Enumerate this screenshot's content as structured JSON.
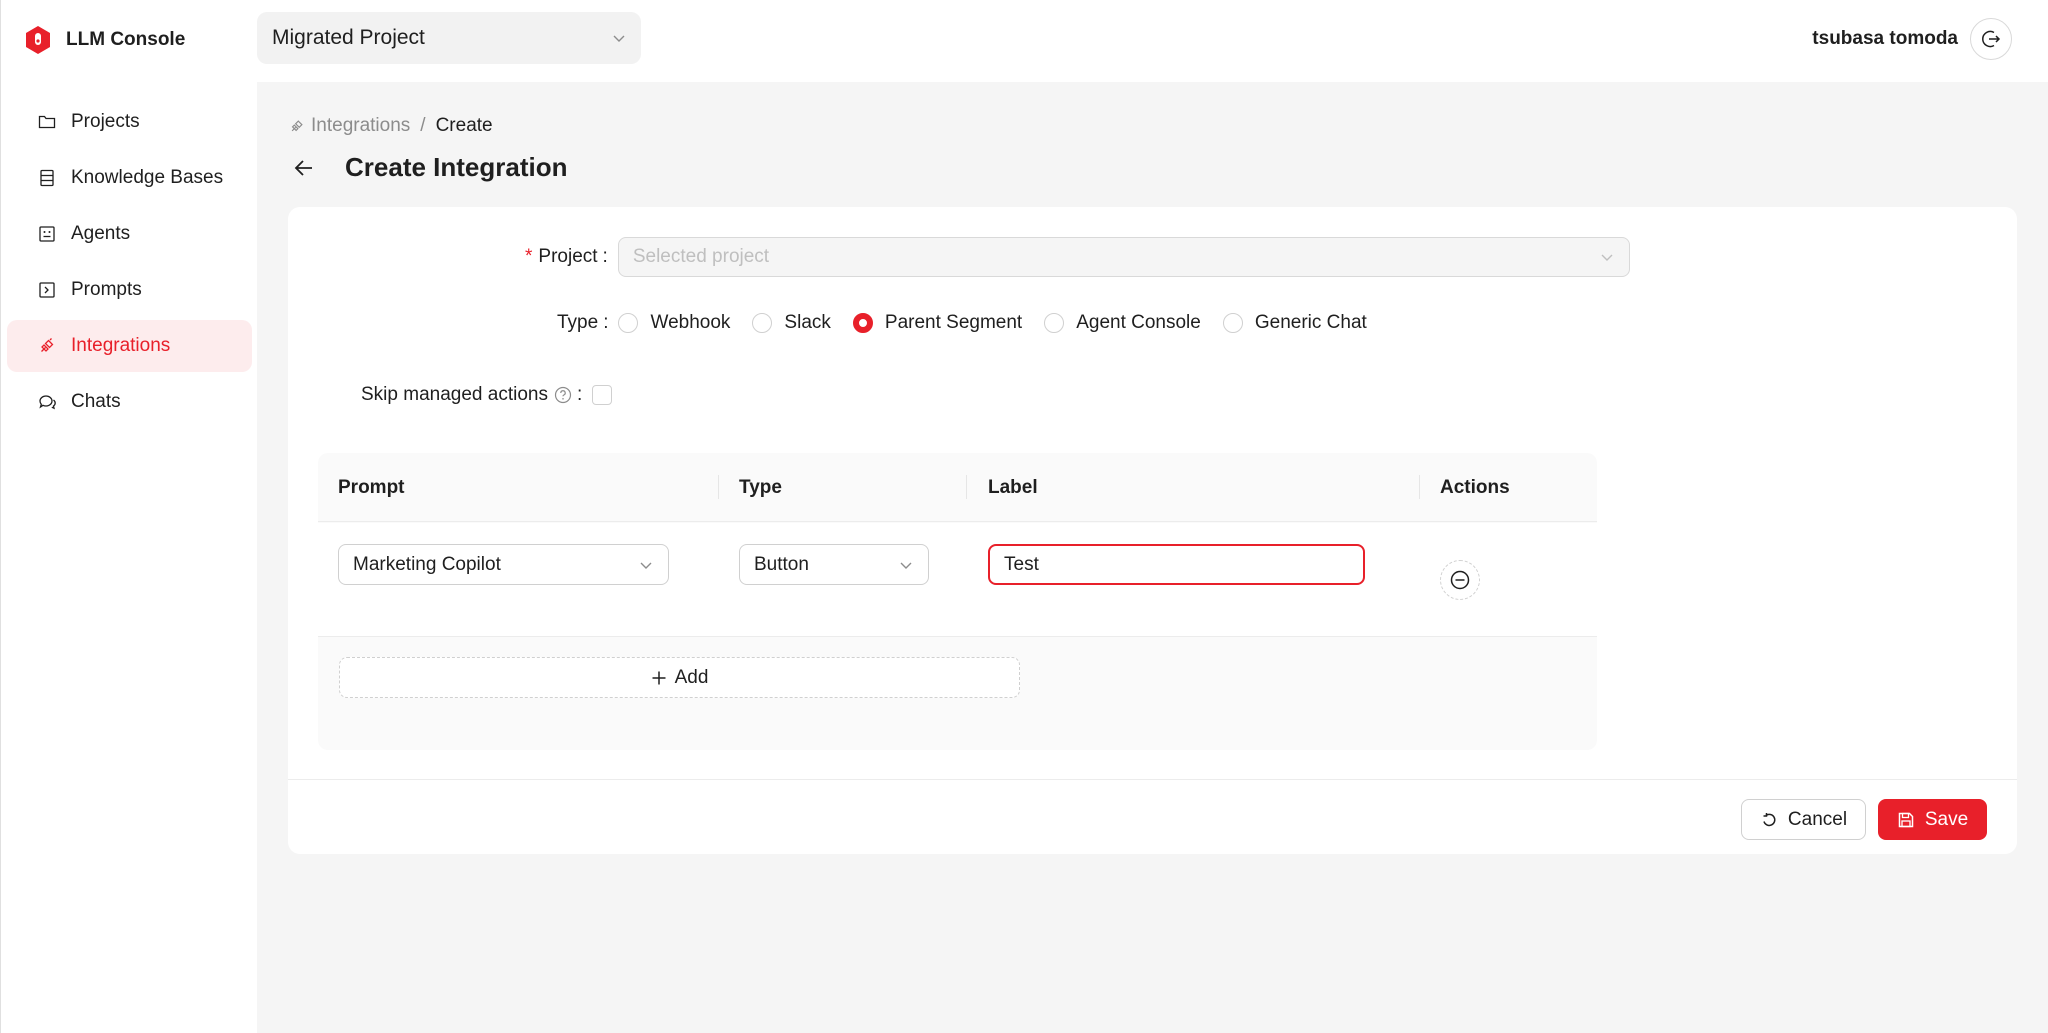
{
  "app": {
    "name": "LLM Console",
    "brand_color": "#e8202a"
  },
  "sidebar": {
    "items": [
      {
        "label": "Projects",
        "icon": "folder-icon",
        "active": false
      },
      {
        "label": "Knowledge Bases",
        "icon": "database-icon",
        "active": false
      },
      {
        "label": "Agents",
        "icon": "robot-icon",
        "active": false
      },
      {
        "label": "Prompts",
        "icon": "prompt-icon",
        "active": false
      },
      {
        "label": "Integrations",
        "icon": "plug-icon",
        "active": true
      },
      {
        "label": "Chats",
        "icon": "chat-icon",
        "active": false
      }
    ]
  },
  "header": {
    "project_selector": {
      "value": "Migrated Project",
      "icon": "chevron-down-icon"
    },
    "user_name": "tsubasa tomoda",
    "logout_icon": "logout-icon"
  },
  "breadcrumb": {
    "link": "Integrations",
    "separator": "/",
    "current": "Create"
  },
  "page_title": "Create Integration",
  "form": {
    "project": {
      "label": "Project",
      "required": true,
      "placeholder": "Selected project",
      "disabled": true
    },
    "type": {
      "label": "Type",
      "options": [
        "Webhook",
        "Slack",
        "Parent Segment",
        "Agent Console",
        "Generic Chat"
      ],
      "selected": "Parent Segment"
    },
    "skip_managed_actions": {
      "label": "Skip managed actions",
      "checked": false,
      "help_icon": "question-circle-icon"
    }
  },
  "actions_table": {
    "columns": [
      "Prompt",
      "Type",
      "Label",
      "Actions"
    ],
    "rows": [
      {
        "prompt": "Marketing Copilot",
        "type": "Button",
        "label": "Test",
        "remove_icon": "minus-circle-icon"
      }
    ],
    "add_label": "Add"
  },
  "footer": {
    "cancel_label": "Cancel",
    "save_label": "Save"
  }
}
